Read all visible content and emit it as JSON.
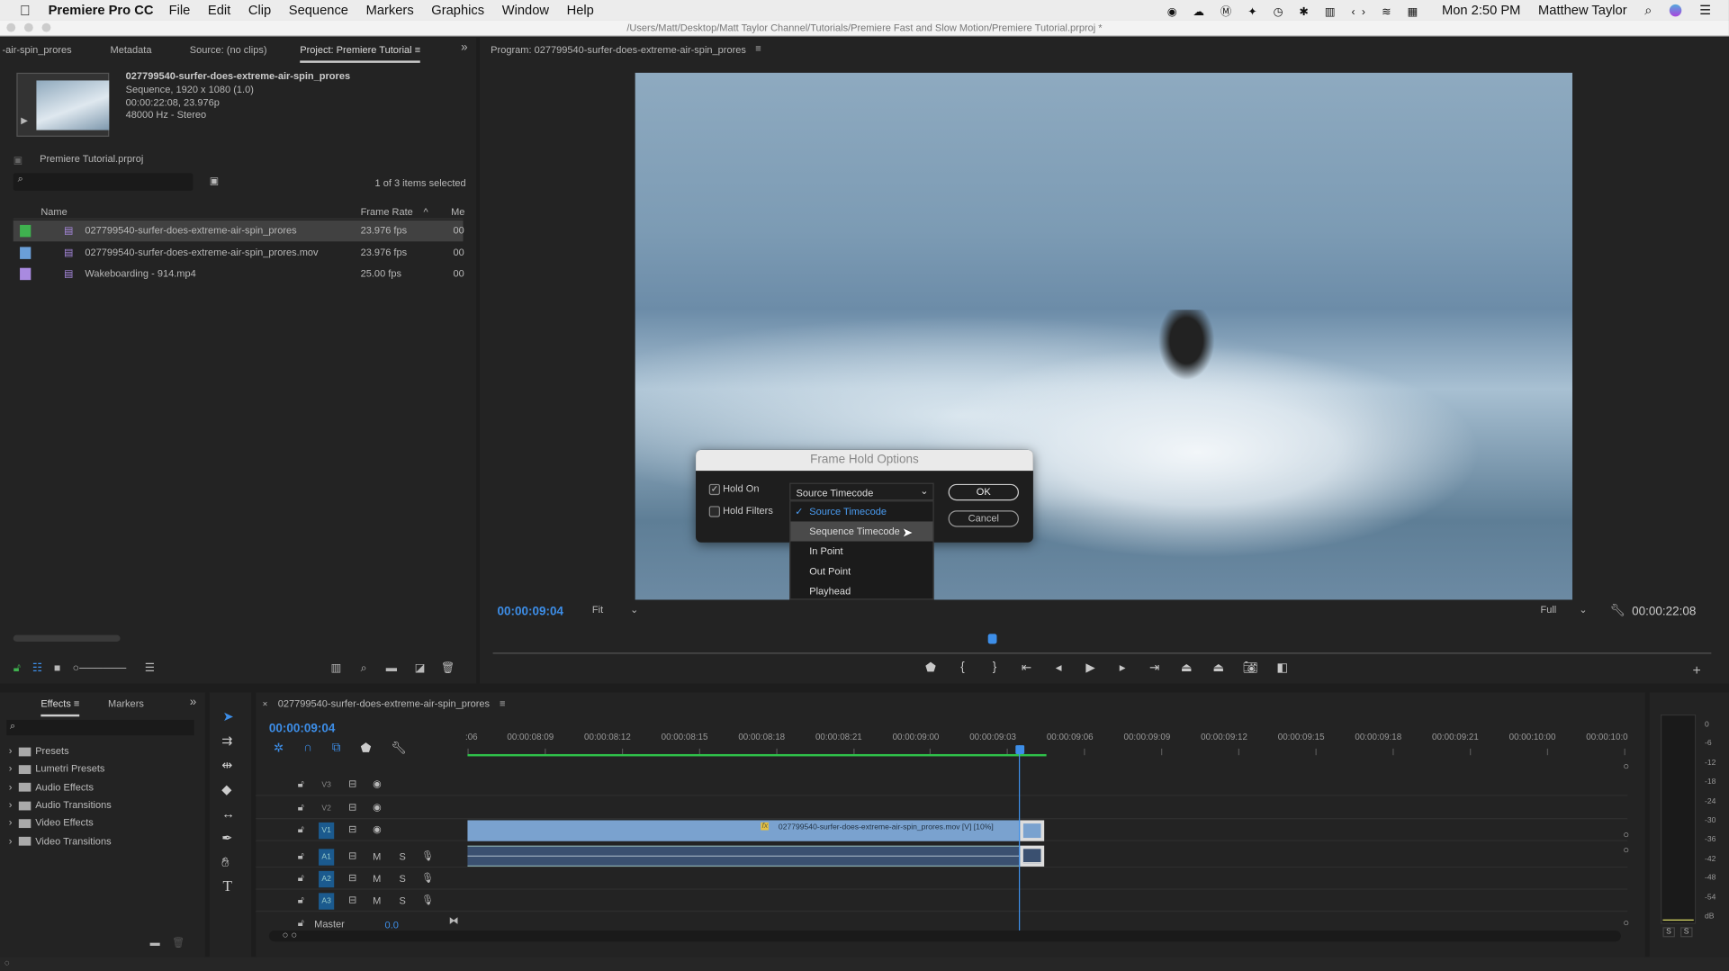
{
  "menubar": {
    "app": "Premiere Pro CC",
    "items": [
      "File",
      "Edit",
      "Clip",
      "Sequence",
      "Markers",
      "Graphics",
      "Window",
      "Help"
    ],
    "clock": "Mon 2:50 PM",
    "user": "Matthew Taylor"
  },
  "window": {
    "path": "/Users/Matt/Desktop/Matt Taylor Channel/Tutorials/Premiere Fast and Slow Motion/Premiere Tutorial.prproj *"
  },
  "left_tabs": [
    "-air-spin_prores",
    "Metadata",
    "Source: (no clips)",
    "Project: Premiere Tutorial"
  ],
  "project": {
    "clip_name": "027799540-surfer-does-extreme-air-spin_prores",
    "info": [
      "Sequence, 1920 x 1080 (1.0)",
      "00:00:22:08, 23.976p",
      "48000 Hz - Stereo"
    ],
    "file": "Premiere Tutorial.prproj",
    "selection": "1 of 3 items selected",
    "columns": [
      "Name",
      "Frame Rate",
      "Me"
    ],
    "rows": [
      {
        "name": "027799540-surfer-does-extreme-air-spin_prores",
        "rate": "23.976 fps",
        "me": "00",
        "color": "#3fb24f"
      },
      {
        "name": "027799540-surfer-does-extreme-air-spin_prores.mov",
        "rate": "23.976 fps",
        "me": "00",
        "color": "#6a9fd8"
      },
      {
        "name": "Wakeboarding - 914.mp4",
        "rate": "25.00 fps",
        "me": "00",
        "color": "#a98ae0"
      }
    ]
  },
  "program": {
    "title": "Program: 027799540-surfer-does-extreme-air-spin_prores",
    "timecode": "00:00:09:04",
    "fit": "Fit",
    "quality": "Full",
    "duration": "00:00:22:08",
    "playhead_fraction": 0.41
  },
  "dialog": {
    "title": "Frame Hold Options",
    "hold_on": {
      "label": "Hold On",
      "checked": true
    },
    "hold_filters": {
      "label": "Hold Filters",
      "checked": false
    },
    "selected": "Source Timecode",
    "ok": "OK",
    "cancel": "Cancel",
    "options": [
      "Source Timecode",
      "Sequence Timecode",
      "In Point",
      "Out Point",
      "Playhead"
    ],
    "highlighted": "Sequence Timecode"
  },
  "effects": {
    "tabs": [
      "Effects",
      "Markers"
    ],
    "items": [
      "Presets",
      "Lumetri Presets",
      "Audio Effects",
      "Audio Transitions",
      "Video Effects",
      "Video Transitions"
    ]
  },
  "timeline": {
    "title": "027799540-surfer-does-extreme-air-spin_prores",
    "timecode": "00:00:09:04",
    "ruler": [
      ":06",
      "00:00:08:09",
      "00:00:08:12",
      "00:00:08:15",
      "00:00:08:18",
      "00:00:08:21",
      "00:00:09:00",
      "00:00:09:03",
      "00:00:09:06",
      "00:00:09:09",
      "00:00:09:12",
      "00:00:09:15",
      "00:00:09:18",
      "00:00:09:21",
      "00:00:10:00",
      "00:00:10:0"
    ],
    "video_tracks": [
      "V3",
      "V2",
      "V1"
    ],
    "audio_tracks": [
      "A1",
      "A2",
      "A3"
    ],
    "mute": "M",
    "solo": "S",
    "master": "Master",
    "master_value": "0.0",
    "clip_label": "027799540-surfer-does-extreme-air-spin_prores.mov [V] [10%]",
    "fx_badge": "fx"
  },
  "meter": {
    "scale": [
      "0",
      "-6",
      "-12",
      "-18",
      "-24",
      "-30",
      "-36",
      "-42",
      "-48",
      "-54",
      "dB"
    ],
    "solo": [
      "S",
      "S"
    ]
  },
  "colors": {
    "accent": "#3d8ee8",
    "clip_video": "#7aa2cf",
    "clip_audio": "#3a5070",
    "render_bar": "#2fc14a"
  }
}
